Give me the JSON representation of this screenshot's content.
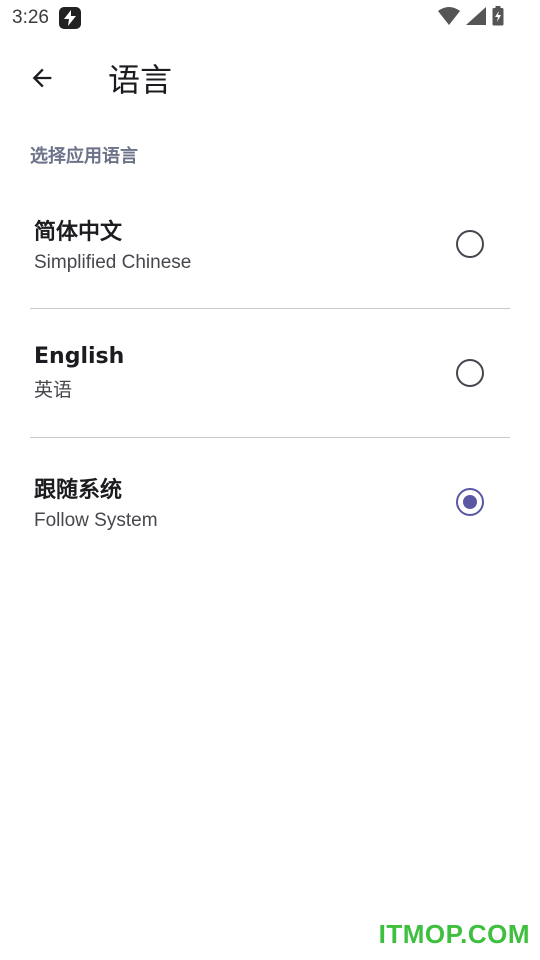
{
  "status_bar": {
    "time": "3:26",
    "icons": [
      "wifi-icon",
      "cell-signal-icon",
      "battery-charging-icon"
    ]
  },
  "app_bar": {
    "back_icon": "arrow-left-icon",
    "title": "语言"
  },
  "section": {
    "title": "选择应用语言"
  },
  "languages": [
    {
      "primary": "简体中文",
      "secondary": "Simplified Chinese",
      "selected": false
    },
    {
      "primary": "English",
      "secondary": "英语",
      "selected": false
    },
    {
      "primary": "跟随系统",
      "secondary": "Follow System",
      "selected": true
    }
  ],
  "colors": {
    "accent": "#5a58a4",
    "section_title": "#6c7389",
    "watermark": "#3fbf3f"
  },
  "watermark": "ITMOP.COM"
}
